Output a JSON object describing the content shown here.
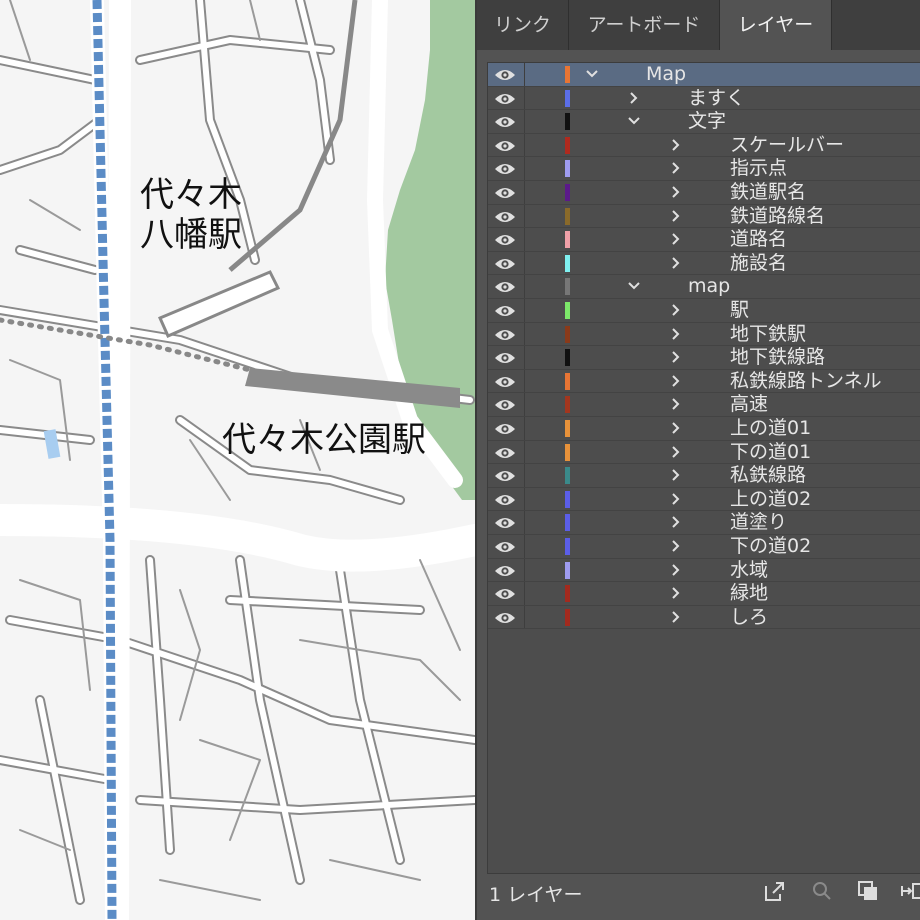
{
  "map": {
    "labels": {
      "yoyogi_hachiman_line1": "代々木",
      "yoyogi_hachiman_line2": "八幡駅",
      "yoyogi_koen": "代々木公園駅"
    },
    "colors": {
      "park": "#a3c9a0",
      "road": "#ffffff",
      "road_edge": "#8a8a8a",
      "railway": "#5b8cc6",
      "station": "#8a8a8a"
    }
  },
  "panel": {
    "tabs": [
      {
        "label": "リンク",
        "active": false
      },
      {
        "label": "アートボード",
        "active": false
      },
      {
        "label": "レイヤー",
        "active": true
      }
    ],
    "layers": [
      {
        "name": "Map",
        "level": 0,
        "expanded": true,
        "color": "#e87534",
        "selected": true
      },
      {
        "name": "ますく",
        "level": 1,
        "expanded": false,
        "color": "#5b6ee8"
      },
      {
        "name": "文字",
        "level": 1,
        "expanded": true,
        "color": "#111111"
      },
      {
        "name": "スケールバー",
        "level": 2,
        "expanded": false,
        "color": "#b02a1e"
      },
      {
        "name": "指示点",
        "level": 2,
        "expanded": false,
        "color": "#9f9cf0"
      },
      {
        "name": "鉄道駅名",
        "level": 2,
        "expanded": false,
        "color": "#5b1a8a"
      },
      {
        "name": "鉄道路線名",
        "level": 2,
        "expanded": false,
        "color": "#8a6a2a"
      },
      {
        "name": "道路名",
        "level": 2,
        "expanded": false,
        "color": "#f0a0a8"
      },
      {
        "name": "施設名",
        "level": 2,
        "expanded": false,
        "color": "#7ff0f0"
      },
      {
        "name": "map",
        "level": 1,
        "expanded": true,
        "color": "#777777"
      },
      {
        "name": "駅",
        "level": 2,
        "expanded": false,
        "color": "#7de86a"
      },
      {
        "name": "地下鉄駅",
        "level": 2,
        "expanded": false,
        "color": "#8a3a1a"
      },
      {
        "name": "地下鉄線路",
        "level": 2,
        "expanded": false,
        "color": "#111111"
      },
      {
        "name": "私鉄線路トンネル",
        "level": 2,
        "expanded": false,
        "color": "#e87534"
      },
      {
        "name": "高速",
        "level": 2,
        "expanded": false,
        "color": "#a3361e"
      },
      {
        "name": "上の道01",
        "level": 2,
        "expanded": false,
        "color": "#e8923a"
      },
      {
        "name": "下の道01",
        "level": 2,
        "expanded": false,
        "color": "#e8923a"
      },
      {
        "name": "私鉄線路",
        "level": 2,
        "expanded": false,
        "color": "#3a8a8a"
      },
      {
        "name": "上の道02",
        "level": 2,
        "expanded": false,
        "color": "#5b5ee8"
      },
      {
        "name": "道塗り",
        "level": 2,
        "expanded": false,
        "color": "#5b5ee8"
      },
      {
        "name": "下の道02",
        "level": 2,
        "expanded": false,
        "color": "#5b5ee8"
      },
      {
        "name": "水域",
        "level": 2,
        "expanded": false,
        "color": "#9f9cf0"
      },
      {
        "name": "緑地",
        "level": 2,
        "expanded": false,
        "color": "#a32a1e"
      },
      {
        "name": "しろ",
        "level": 2,
        "expanded": false,
        "color": "#a32a1e"
      }
    ],
    "footer": {
      "count_label": "1 レイヤー"
    },
    "icons": {
      "visibility": "eye-icon",
      "collapse": "chevron-right-icon",
      "expand": "chevron-down-icon",
      "export": "export-icon",
      "search": "search-icon",
      "mask": "clipping-mask-icon",
      "collect": "collect-icon"
    }
  }
}
